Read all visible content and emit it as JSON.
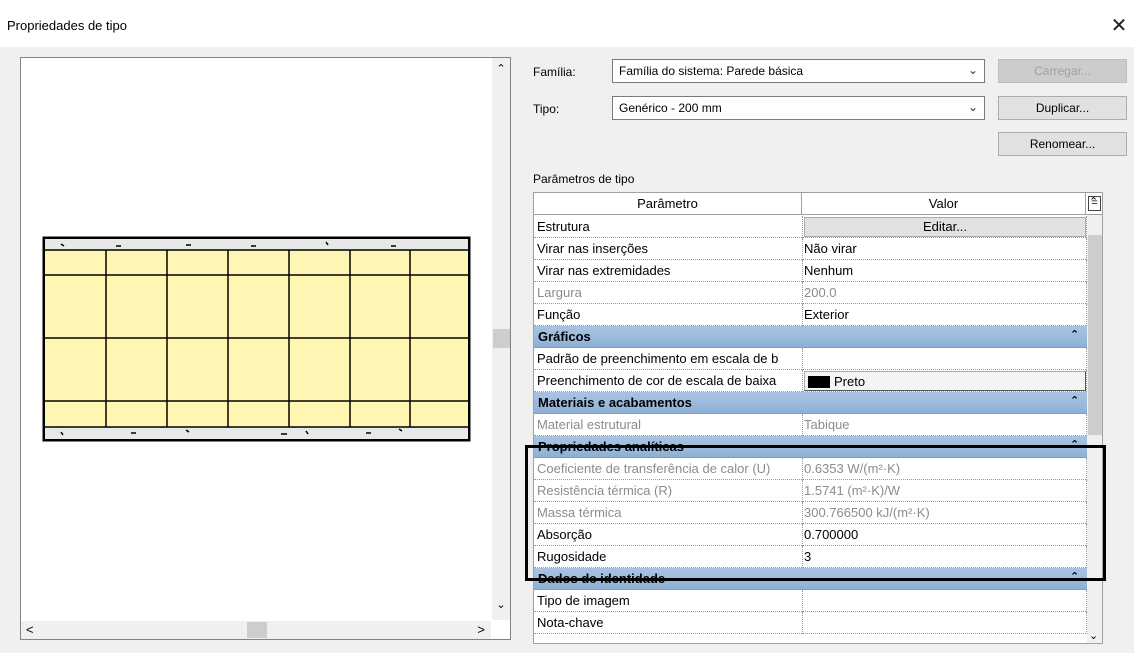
{
  "window": {
    "title": "Propriedades de tipo",
    "close_glyph": "✕"
  },
  "preview": {
    "scroll_up": "⌃",
    "scroll_down": "⌄",
    "scroll_left": "<",
    "scroll_right": ">"
  },
  "form": {
    "family_label": "Família:",
    "family_value": "Família do sistema: Parede básica",
    "type_label": "Tipo:",
    "type_value": "Genérico - 200 mm",
    "chevron": "⌄",
    "load_button": "Carregar...",
    "duplicate_button": "Duplicar...",
    "rename_button": "Renomear...",
    "params_title": "Parâmetros de tipo"
  },
  "table": {
    "col_param": "Parâmetro",
    "col_value": "Valor",
    "eq_symbol": "=",
    "collapse_glyph": "⌃",
    "rows_top": [
      {
        "k": "Estrutura",
        "v": "Editar...",
        "kind": "button"
      },
      {
        "k": "Virar nas inserções",
        "v": "Não virar"
      },
      {
        "k": "Virar nas extremidades",
        "v": "Nenhum"
      },
      {
        "k": "Largura",
        "v": "200.0",
        "dim": true
      },
      {
        "k": "Função",
        "v": "Exterior"
      }
    ],
    "group_graficos": "Gráficos",
    "rows_graficos": [
      {
        "k": "Padrão de preenchimento em escala de b",
        "v": ""
      },
      {
        "k": "Preenchimento de cor de escala de baixa",
        "v": "Preto",
        "kind": "swatch",
        "swatch_color": "#000000"
      }
    ],
    "group_materiais": "Materiais e acabamentos",
    "rows_materiais": [
      {
        "k": "Material estrutural",
        "v": "Tabique",
        "dim": true
      }
    ],
    "group_analiticas": "Propriedades analíticas",
    "rows_analiticas": [
      {
        "k": "Coeficiente de transferência de calor (U)",
        "v": "0.6353 W/(m²·K)",
        "dim": true
      },
      {
        "k": "Resistência térmica (R)",
        "v": "1.5741 (m²·K)/W",
        "dim": true
      },
      {
        "k": "Massa térmica",
        "v": "300.766500 kJ/(m²·K)",
        "dim": true
      },
      {
        "k": "Absorção",
        "v": "0.700000"
      },
      {
        "k": "Rugosidade",
        "v": "3"
      }
    ],
    "group_identidade": "Dados de identidade",
    "rows_identidade": [
      {
        "k": "Tipo de imagem",
        "v": ""
      },
      {
        "k": "Nota-chave",
        "v": ""
      }
    ]
  },
  "colors": {
    "wall_fill": "#fff6b3",
    "group_header": "#9bbbdd"
  }
}
